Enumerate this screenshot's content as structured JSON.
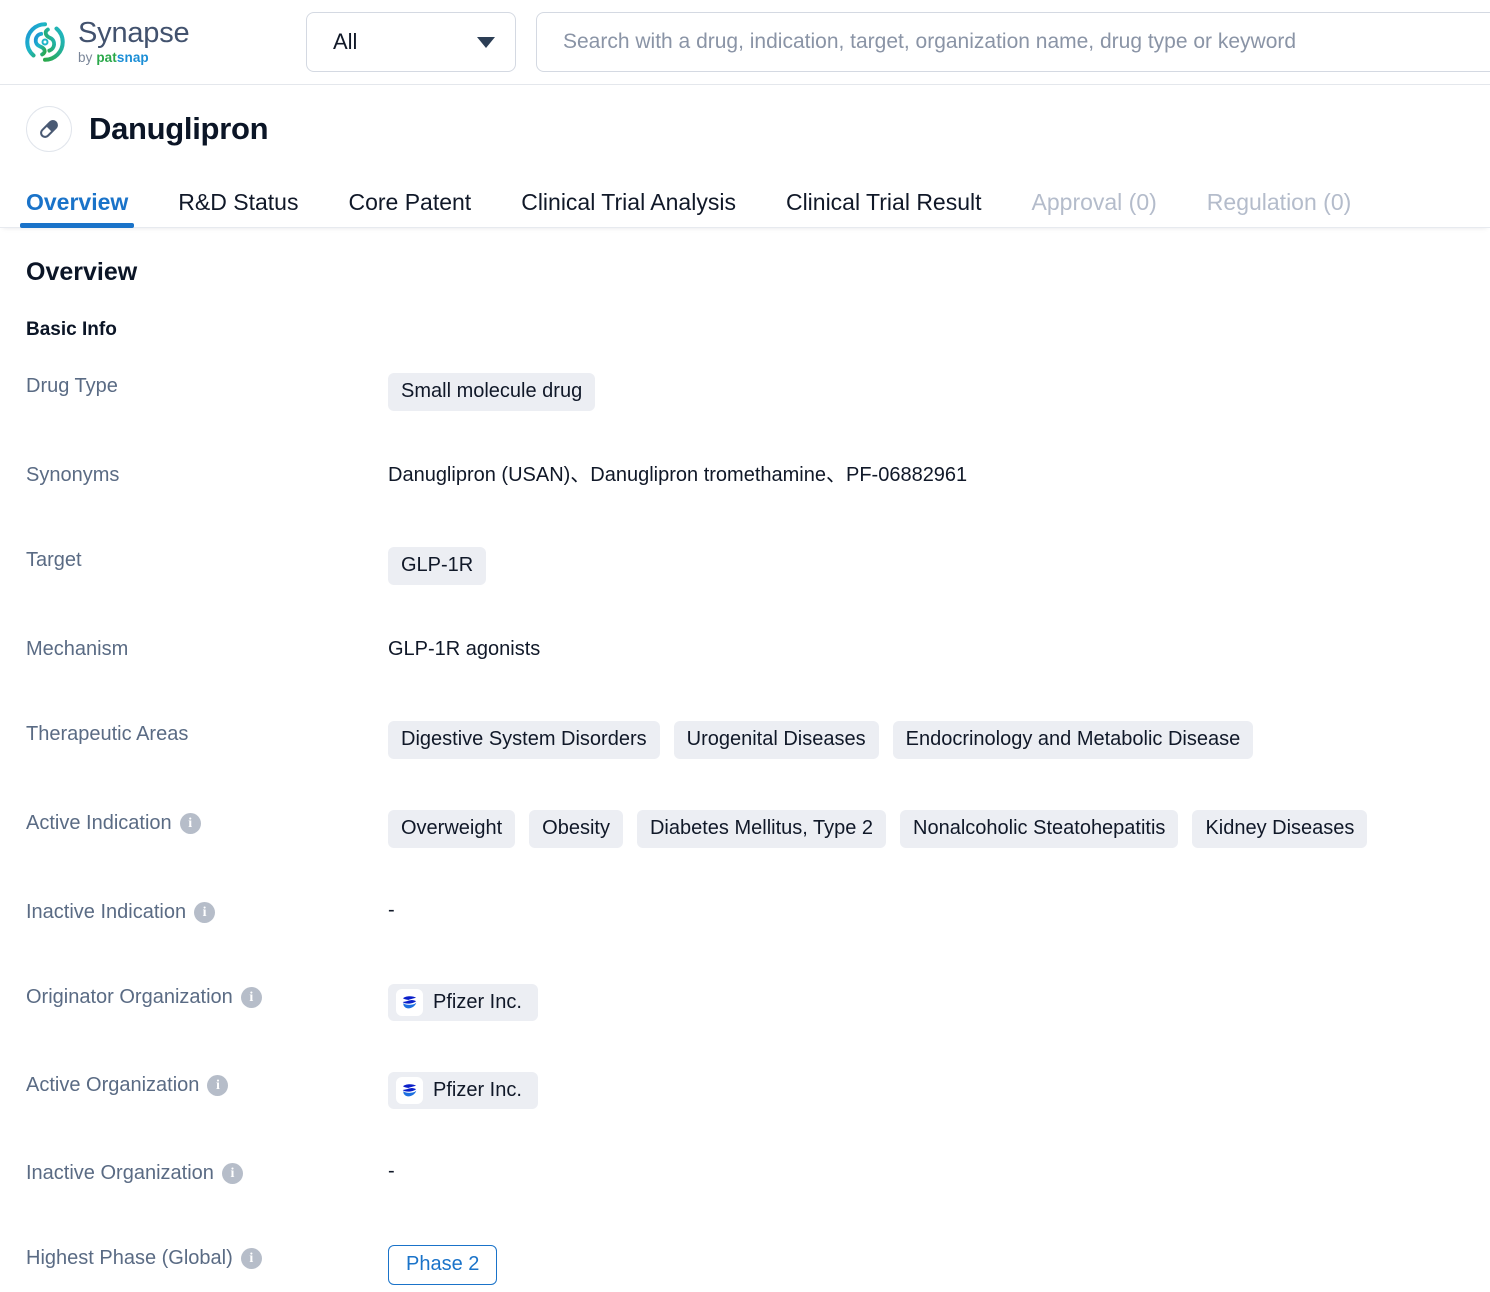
{
  "brand": {
    "name": "Synapse",
    "by": "by ",
    "pat": "pat",
    "snap": "snap",
    "logo_colors": {
      "blue": "#1b8ed6",
      "cyan": "#1fb6c9",
      "green": "#2aa84a"
    }
  },
  "search": {
    "scope_label": "All",
    "placeholder": "Search with a drug, indication, target, organization name, drug type or keyword",
    "value": ""
  },
  "drug": {
    "title": "Danuglipron",
    "icon": "pill-capsule-icon"
  },
  "tabs": [
    {
      "label": "Overview",
      "state": "active"
    },
    {
      "label": "R&D Status",
      "state": "normal"
    },
    {
      "label": "Core Patent",
      "state": "normal"
    },
    {
      "label": "Clinical Trial Analysis",
      "state": "normal"
    },
    {
      "label": "Clinical Trial Result",
      "state": "normal"
    },
    {
      "label": "Approval (0)",
      "state": "disabled"
    },
    {
      "label": "Regulation (0)",
      "state": "disabled"
    }
  ],
  "overview": {
    "section_title": "Overview",
    "subsection_title": "Basic Info",
    "rows": {
      "drug_type": {
        "label": "Drug Type",
        "tags": [
          "Small molecule drug"
        ]
      },
      "synonyms": {
        "label": "Synonyms",
        "text": "Danuglipron (USAN)、Danuglipron tromethamine、PF-06882961"
      },
      "target": {
        "label": "Target",
        "tags": [
          "GLP-1R"
        ]
      },
      "mechanism": {
        "label": "Mechanism",
        "text": "GLP-1R agonists"
      },
      "therapeutic_areas": {
        "label": "Therapeutic Areas",
        "tags": [
          "Digestive System Disorders",
          "Urogenital Diseases",
          "Endocrinology and Metabolic Disease"
        ]
      },
      "active_indication": {
        "label": "Active Indication",
        "has_info": true,
        "tags": [
          "Overweight",
          "Obesity",
          "Diabetes Mellitus, Type 2",
          "Nonalcoholic Steatohepatitis",
          "Kidney Diseases"
        ]
      },
      "inactive_indication": {
        "label": "Inactive Indication",
        "has_info": true,
        "text": "-"
      },
      "originator_organization": {
        "label": "Originator Organization",
        "has_info": true,
        "orgs": [
          {
            "name": "Pfizer Inc.",
            "logo": "pfizer-logo-icon"
          }
        ]
      },
      "active_organization": {
        "label": "Active Organization",
        "has_info": true,
        "orgs": [
          {
            "name": "Pfizer Inc.",
            "logo": "pfizer-logo-icon"
          }
        ]
      },
      "inactive_organization": {
        "label": "Inactive Organization",
        "has_info": true,
        "text": "-"
      },
      "highest_phase_global": {
        "label": "Highest Phase (Global)",
        "has_info": true,
        "badge": "Phase 2"
      }
    },
    "info_glyph": "i"
  },
  "colors": {
    "accent": "#1a73c9",
    "label_text": "#5a6b84",
    "value_text": "#101828",
    "tag_bg": "#eceef3",
    "disabled_tab": "#b4bccb"
  }
}
